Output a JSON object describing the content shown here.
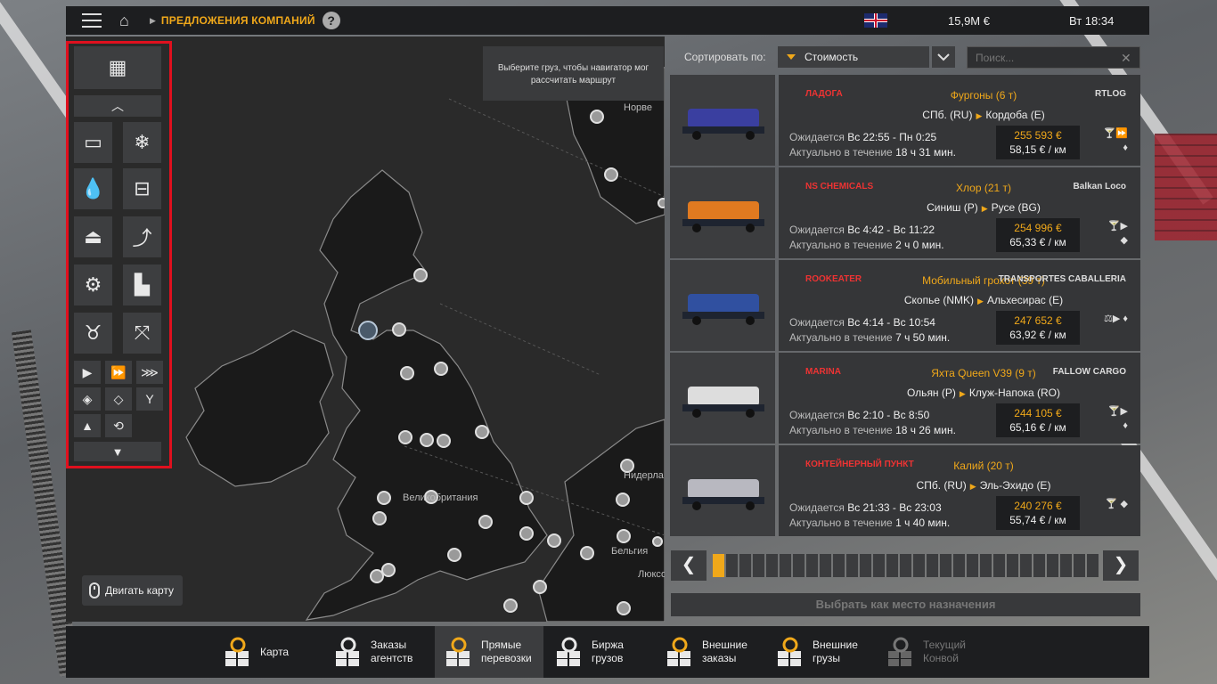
{
  "topbar": {
    "breadcrumb": "ПРЕДЛОЖЕНИЯ КОМПАНИЙ",
    "help": "?",
    "money": "15,9M €",
    "time": "Вт 18:34"
  },
  "map": {
    "hint": "Выберите груз, чтобы навигатор мог рассчитать маршрут",
    "labels": [
      "Норве",
      "Великобритания",
      "Нидерла",
      "Бельгия",
      "Люксо"
    ],
    "move_button": "Двигать карту"
  },
  "filters": {
    "icons": [
      "cargo-stack-icon",
      "chevron-up-icon",
      "box-trailer-icon",
      "snowflake-icon",
      "liquid-drop-icon",
      "flatbed-icon",
      "bulk-icon",
      "lowboy-icon",
      "gears-icon",
      "heavy-machinery-icon",
      "livestock-icon",
      "oversize-icon",
      "speed-1-icon",
      "speed-2-icon",
      "speed-3-icon",
      "hazard-diamond-icon",
      "valuable-gem-icon",
      "fragile-glass-icon",
      "weight-icon",
      "double-trailer-icon",
      "filter-icon"
    ]
  },
  "sort": {
    "label": "Сортировать по:",
    "value": "Стоимость",
    "search_placeholder": "Поиск..."
  },
  "offers": [
    {
      "cargo": "Фургоны (6 т)",
      "from": "СПб. (RU)",
      "to": "Кордоба (E)",
      "expected_label": "Ожидается",
      "expected": "Вс 22:55 - Пн 0:25",
      "valid_label": "Актуально в течение",
      "valid": "18 ч 31 мин.",
      "price": "255 593 €",
      "per_km": "58,15 € / км",
      "logo_left": "ЛАДОГА",
      "logo_right": "RTLOG",
      "tags": "🍸⏩ ♦",
      "thumb_color": "#3a3fa0"
    },
    {
      "cargo": "Хлор (21 т)",
      "from": "Синиш (P)",
      "to": "Русе (BG)",
      "expected_label": "Ожидается",
      "expected": "Вс 4:42 - Вс 11:22",
      "valid_label": "Актуально в течение",
      "valid": "2 ч 0 мин.",
      "price": "254 996 €",
      "per_km": "65,33 € / км",
      "logo_left": "NS CHEMICALS",
      "logo_right": "Balkan Loco",
      "tags": "🍸▶ ◆",
      "thumb_color": "#e07a20"
    },
    {
      "cargo": "Мобильный грохот (39 т)",
      "from": "Скопье (NMK)",
      "to": "Альхесирас (E)",
      "expected_label": "Ожидается",
      "expected": "Вс 4:14 - Вс 10:54",
      "valid_label": "Актуально в течение",
      "valid": "7 ч 50 мин.",
      "price": "247 652 €",
      "per_km": "63,92 € / км",
      "logo_left": "ROOKEATER",
      "logo_right": "TRANSPORTES CABALLERIA",
      "tags": "⚖▶ ♦",
      "thumb_color": "#3050a0"
    },
    {
      "cargo": "Яхта Queen V39 (9 т)",
      "from": "Ольян (P)",
      "to": "Клуж-Напока (RO)",
      "expected_label": "Ожидается",
      "expected": "Вс 2:10 - Вс 8:50",
      "valid_label": "Актуально в течение",
      "valid": "18 ч 26 мин.",
      "price": "244 105 €",
      "per_km": "65,16 € / км",
      "logo_left": "MARINA",
      "logo_right": "FALLOW CARGO",
      "tags": "🍸▶ ♦",
      "thumb_color": "#dddddd"
    },
    {
      "cargo": "Калий (20 т)",
      "from": "СПб. (RU)",
      "to": "Эль-Эхидо (E)",
      "expected_label": "Ожидается",
      "expected": "Вс 21:33 - Вс 23:03",
      "valid_label": "Актуально в течение",
      "valid": "1 ч 40 мин.",
      "price": "240 276 €",
      "per_km": "55,74 € / км",
      "logo_left": "КОНТЕЙНЕРНЫЙ ПУНКТ",
      "logo_right": "",
      "tags": "🍸 ◆",
      "thumb_color": "#b8b8c0"
    }
  ],
  "pager": {
    "total": 29,
    "active": 1
  },
  "select_destination": "Выбрать как место назначения",
  "tabs": [
    {
      "label": "Карта",
      "state": "normal"
    },
    {
      "label": "Заказы\nагентств",
      "state": "normal"
    },
    {
      "label": "Прямые\nперевозки",
      "state": "active"
    },
    {
      "label": "Биржа\nгрузов",
      "state": "normal"
    },
    {
      "label": "Внешние\nзаказы",
      "state": "normal"
    },
    {
      "label": "Внешние\nгрузы",
      "state": "normal"
    },
    {
      "label": "Текущий\nКонвой",
      "state": "disabled"
    }
  ],
  "colors": {
    "accent": "#f0a81a",
    "panel": "#1d1e20",
    "card": "#353638",
    "filter_border": "#e0101e"
  }
}
